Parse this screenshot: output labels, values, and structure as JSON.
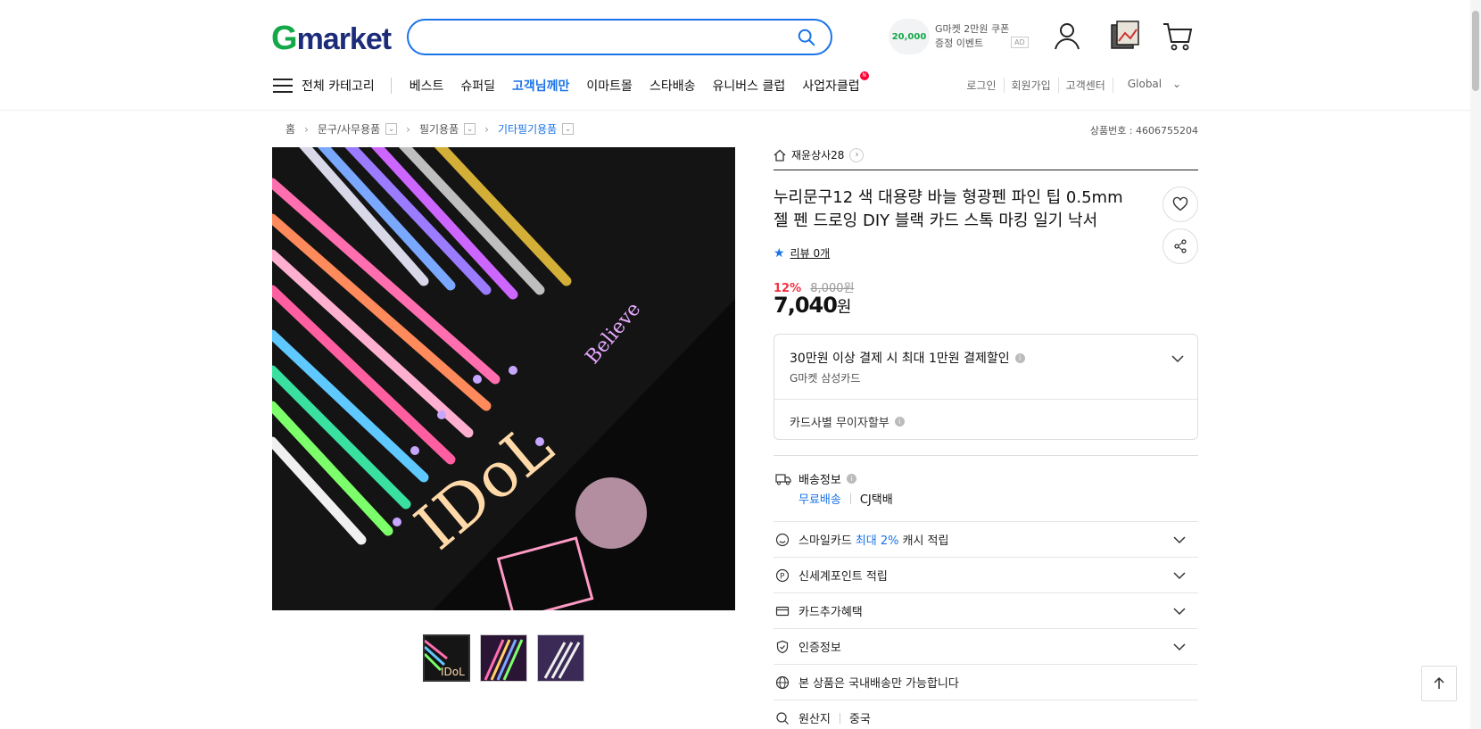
{
  "header": {
    "logo": "Gmarket",
    "search_placeholder": "",
    "ad": {
      "amount": "20,000",
      "text": "G마켓 2만원 쿠폰 증정 이벤트",
      "badge": "AD"
    }
  },
  "nav": {
    "all_category": "전체 카테고리",
    "links": [
      "베스트",
      "슈퍼딜",
      "고객님께만",
      "이마트몰",
      "스타배송",
      "유니버스 클럽",
      "사업자클럽"
    ],
    "new_badge": "N",
    "util": [
      "로그인",
      "회원가입",
      "고객센터",
      "Global"
    ]
  },
  "breadcrumb": {
    "home": "홈",
    "items": [
      "문구/사무용품",
      "필기용품",
      "기타필기용품"
    ]
  },
  "product_id": "상품번호 : 4606755204",
  "product": {
    "shop": "재윤상사28",
    "title": "누리문구12 색 대용량 바늘 형광펜 파인 팁 0.5mm 젤 펜 드로잉 DIY 블랙 카드 스톡 마킹 일기 낙서",
    "review": "리뷰 0개",
    "discount": "12%",
    "original_price": "8,000원",
    "price": "7,040",
    "price_unit": "원"
  },
  "card_benefit": {
    "main": "30만원 이상 결제 시 최대 1만원 결제할인",
    "sub": "G마켓 삼성카드",
    "installment": "카드사별 무이자할부",
    "info": "i"
  },
  "shipping": {
    "label": "배송정보",
    "free": "무료배송",
    "carrier": "CJ택배"
  },
  "rows": {
    "smilecard_pre": "스마일카드",
    "smilecard_hl": "최대 2%",
    "smilecard_post": "캐시 적립",
    "shinsegae": "신세계포인트 적립",
    "card_extra": "카드추가혜택",
    "cert": "인증정보",
    "domestic": "본 상품은 국내배송만 가능합니다",
    "origin_label": "원산지",
    "origin_value": "중국"
  }
}
